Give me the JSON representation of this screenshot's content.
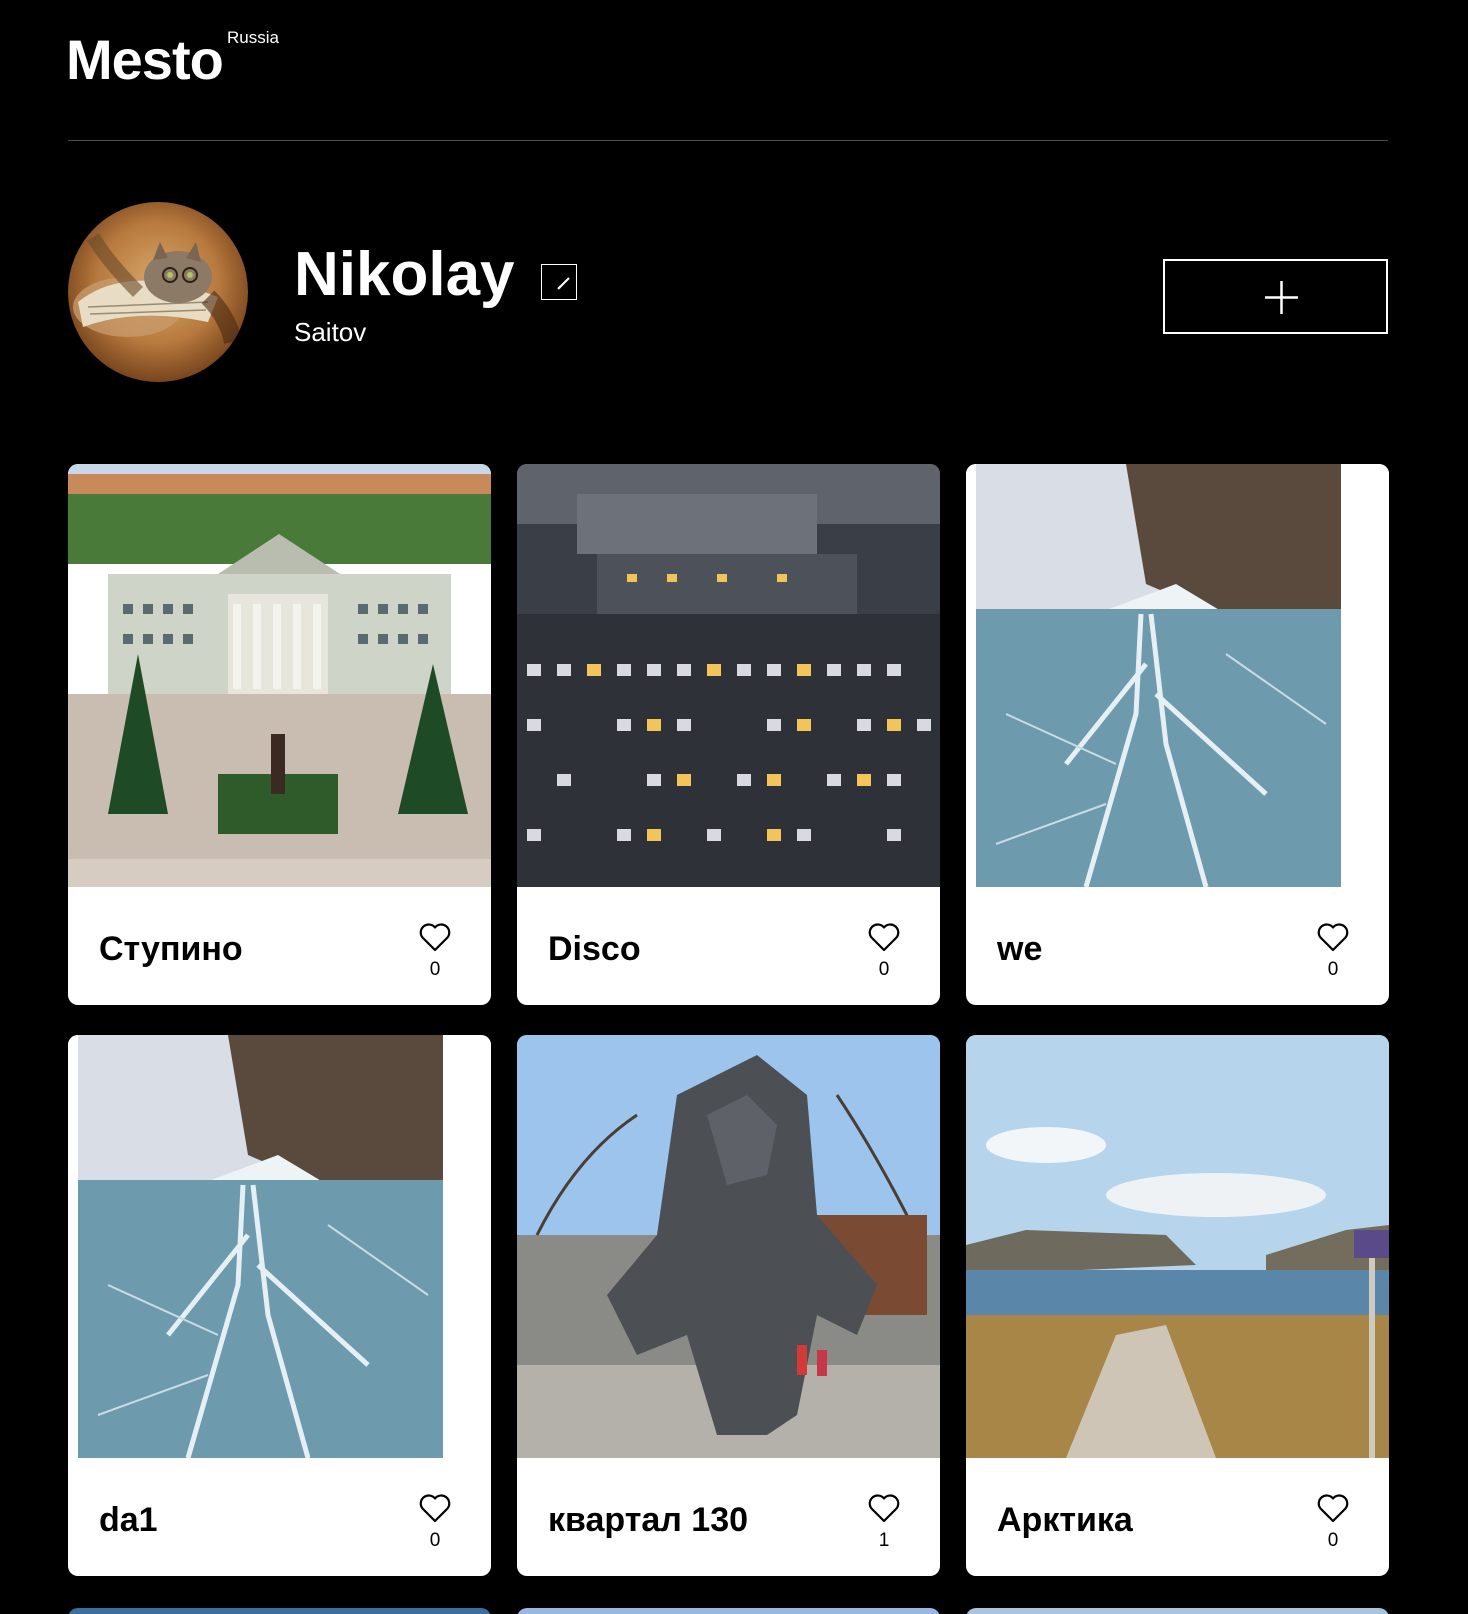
{
  "header": {
    "logo_text": "Mesto",
    "logo_superscript": "Russia"
  },
  "profile": {
    "name": "Nikolay",
    "about": "Saitov",
    "edit_icon": "pencil-icon",
    "add_icon": "plus-icon"
  },
  "cards": [
    {
      "title": "Ступино",
      "likes": "0"
    },
    {
      "title": "Disco",
      "likes": "0"
    },
    {
      "title": "we",
      "likes": "0"
    },
    {
      "title": "da1",
      "likes": "0"
    },
    {
      "title": "квартал 130",
      "likes": "1"
    },
    {
      "title": "Арктика",
      "likes": "0"
    }
  ]
}
